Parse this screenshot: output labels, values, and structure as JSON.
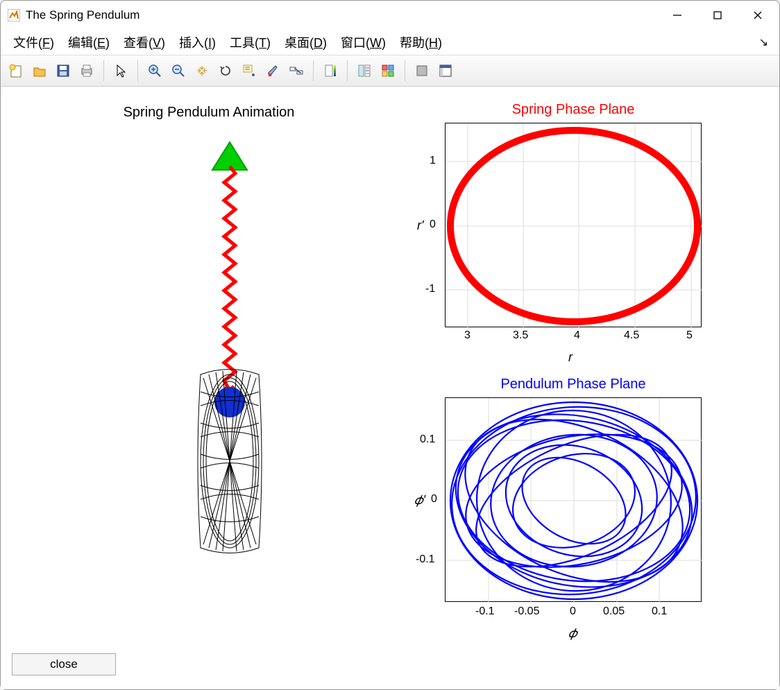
{
  "window": {
    "title": "The Spring Pendulum"
  },
  "menubar": {
    "file": "文件(",
    "file_u": "F",
    "file_end": ")",
    "edit": "编辑(",
    "edit_u": "E",
    "edit_end": ")",
    "view": "查看(",
    "view_u": "V",
    "view_end": ")",
    "insert": "插入(",
    "insert_u": "I",
    "insert_end": ")",
    "tools": "工具(",
    "tools_u": "T",
    "tools_end": ")",
    "desktop": "桌面(",
    "desktop_u": "D",
    "desktop_end": ")",
    "windowm": "窗口(",
    "windowm_u": "W",
    "windowm_end": ")",
    "help": "帮助(",
    "help_u": "H",
    "help_end": ")"
  },
  "plots": {
    "animation_title": "Spring Pendulum Animation",
    "spring_title": "Spring Phase Plane",
    "pendulum_title": "Pendulum Phase Plane",
    "r_label": "r",
    "rp_label": "r'",
    "phi_label": "𝜙",
    "phip_label": "𝜙'"
  },
  "close_button": "close",
  "chart_data": [
    {
      "type": "line",
      "title": "Spring Phase Plane",
      "xlabel": "r",
      "ylabel": "r'",
      "xlim": [
        2.8,
        5.1
      ],
      "ylim": [
        -1.6,
        1.6
      ],
      "xticks": [
        3,
        3.5,
        4,
        4.5,
        5
      ],
      "yticks": [
        -1,
        0,
        1
      ],
      "shape": "thick-ellipse",
      "center": [
        3.95,
        0
      ],
      "rx": 1.12,
      "ry": 1.5,
      "color": "#ff0000"
    },
    {
      "type": "line",
      "title": "Pendulum Phase Plane",
      "xlabel": "phi",
      "ylabel": "phi'",
      "xlim": [
        -0.15,
        0.15
      ],
      "ylim": [
        -0.17,
        0.17
      ],
      "xticks": [
        -0.1,
        -0.05,
        0,
        0.05,
        0.1
      ],
      "yticks": [
        -0.1,
        0,
        0.1
      ],
      "shape": "precessing-ellipses",
      "color": "#0000ff"
    }
  ]
}
